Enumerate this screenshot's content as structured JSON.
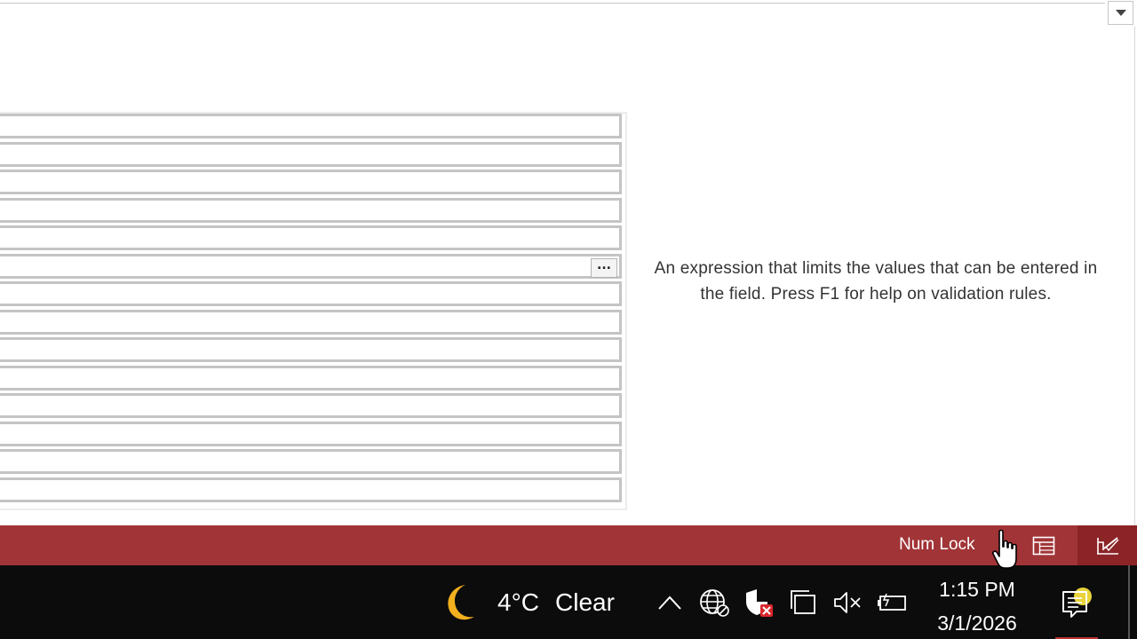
{
  "help": {
    "text": "An expression that limits the values that can be entered in the field. Press F1 for help on validation rules."
  },
  "property_grid": {
    "row_count": 14,
    "builder_button_label": "..."
  },
  "status_bar": {
    "num_lock": "Num Lock",
    "datasheet_view_icon": "datasheet-view-icon",
    "design_view_icon": "design-view-icon",
    "color": "#a13437"
  },
  "taskbar": {
    "weather": {
      "icon": "moon-icon",
      "temperature": "4°C",
      "condition": "Clear"
    },
    "tray_icons": [
      "chevron-up-icon",
      "network-icon",
      "security-icon",
      "copy-icon",
      "speaker-muted-icon",
      "battery-icon"
    ],
    "clock": {
      "time": "1:15 PM",
      "date": "3/1/2026"
    },
    "notification_icon": "notification-icon"
  }
}
